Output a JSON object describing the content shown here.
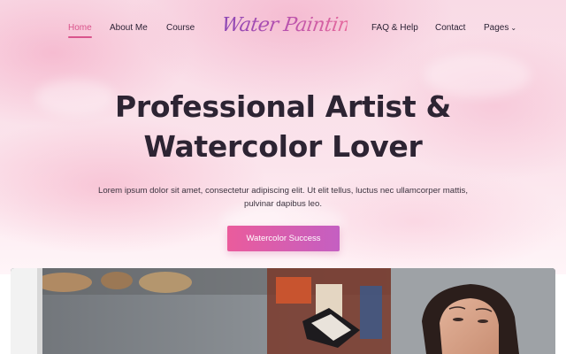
{
  "nav": {
    "items": [
      {
        "label": "Home",
        "active": true
      },
      {
        "label": "About Me"
      },
      {
        "label": "Course"
      },
      {
        "label": "FAQ & Help"
      },
      {
        "label": "Contact"
      },
      {
        "label": "Pages"
      }
    ],
    "pages_chevron": "⌄"
  },
  "logo": {
    "text": "Water Painting"
  },
  "hero": {
    "headline_line1": "Professional Artist &",
    "headline_line2": "Watercolor Lover",
    "subtext": "Lorem ipsum dolor sit amet, consectetur adipiscing elit. Ut elit tellus, luctus nec ullamcorper mattis, pulvinar dapibus leo.",
    "cta_label": "Watercolor Success"
  },
  "colors": {
    "accent_pink": "#d9548c",
    "button_gradient_start": "#ea5c9c",
    "button_gradient_end": "#c45fc2",
    "heading": "#2d2433"
  }
}
